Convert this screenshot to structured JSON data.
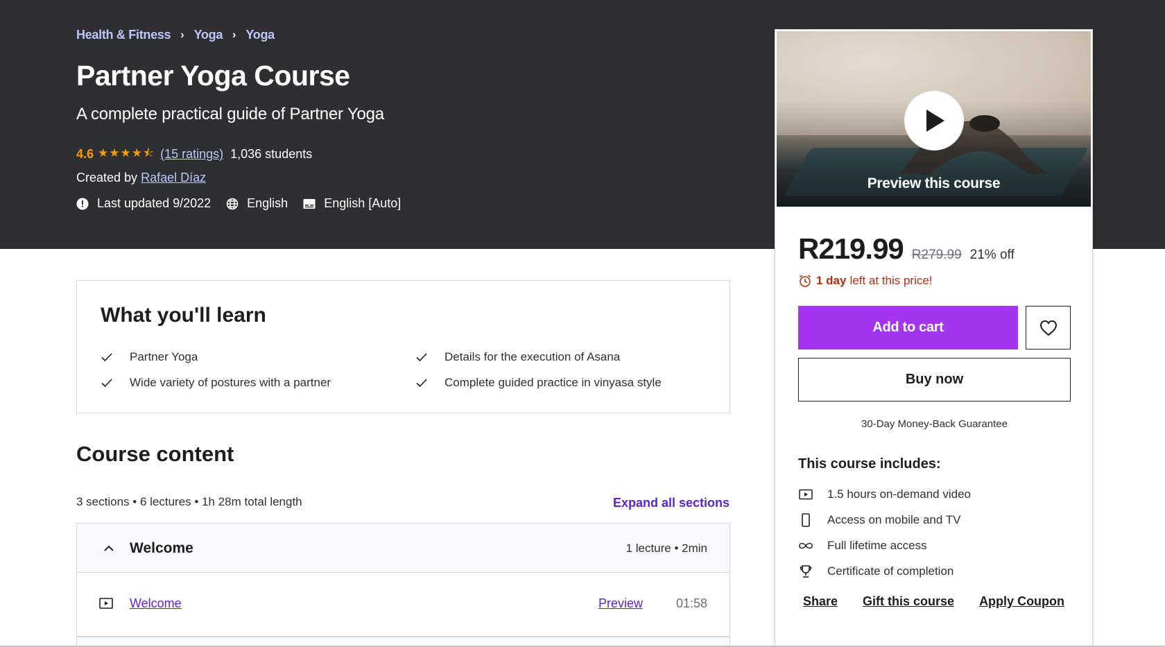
{
  "breadcrumb": [
    "Health & Fitness",
    "Yoga",
    "Yoga"
  ],
  "course": {
    "title": "Partner Yoga Course",
    "subtitle": "A complete practical guide of Partner Yoga",
    "rating": "4.6",
    "stars": "★★★★⯪",
    "ratings_link": "(15 ratings)",
    "students": "1,036 students",
    "created_by_label": "Created by",
    "instructor": "Rafael Díaz",
    "last_updated": "Last updated 9/2022",
    "language": "English",
    "captions": "English [Auto]"
  },
  "learn": {
    "title": "What you'll learn",
    "items": [
      "Partner Yoga",
      "Details for the execution of Asana",
      "Wide variety of postures with a partner",
      "Complete guided practice in vinyasa style"
    ]
  },
  "content": {
    "title": "Course content",
    "meta": "3 sections • 6 lectures • 1h 28m total length",
    "expand_label": "Expand all sections",
    "sections": [
      {
        "name": "Welcome",
        "info": "1 lecture • 2min",
        "lectures": [
          {
            "name": "Welcome",
            "preview": "Preview",
            "time": "01:58"
          }
        ]
      }
    ]
  },
  "card": {
    "preview_label": "Preview this course",
    "price": "R219.99",
    "original_price": "R279.99",
    "discount": "21% off",
    "deadline_bold": "1 day",
    "deadline_rest": "left at this price!",
    "add_to_cart": "Add to cart",
    "buy_now": "Buy now",
    "guarantee": "30-Day Money-Back Guarantee",
    "includes_title": "This course includes:",
    "includes": [
      {
        "icon": "video-icon",
        "text": "1.5 hours on-demand video"
      },
      {
        "icon": "mobile-icon",
        "text": "Access on mobile and TV"
      },
      {
        "icon": "infinity-icon",
        "text": "Full lifetime access"
      },
      {
        "icon": "trophy-icon",
        "text": "Certificate of completion"
      }
    ],
    "links": [
      "Share",
      "Gift this course",
      "Apply Coupon"
    ]
  },
  "colors": {
    "header_bg": "#2d2f31",
    "accent_purple": "#a435f0",
    "link_purple": "#5624d0",
    "light_link": "#c0c4fc",
    "star_orange": "#f69c08",
    "deadline_red": "#b32d0f"
  }
}
